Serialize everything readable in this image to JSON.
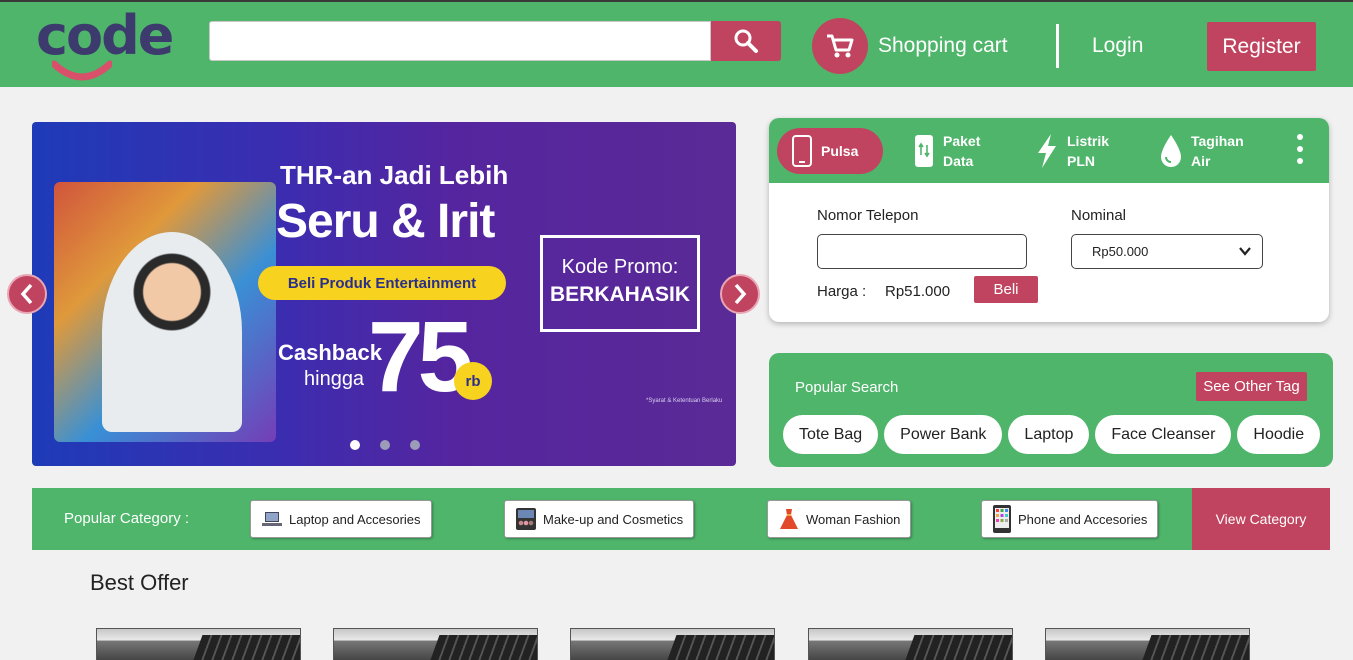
{
  "header": {
    "logo_text": "code",
    "search": {
      "value": "",
      "placeholder": ""
    },
    "cart_label": "Shopping cart",
    "login_label": "Login",
    "register_label": "Register"
  },
  "banner": {
    "line1": "THR-an Jadi Lebih",
    "line2": "Seru & Irit",
    "pill": "Beli Produk Entertainment",
    "cashback": "Cashback",
    "hingga": "hingga",
    "amount": "75",
    "unit": "rb",
    "promo_label": "Kode Promo:",
    "promo_code": "BERKAHASIK",
    "fine_print": "*Syarat & Ketentuan Berlaku",
    "slide_count": 3,
    "active_slide": 1
  },
  "payment": {
    "tabs": [
      {
        "label": "Pulsa",
        "icon": "phone-icon",
        "active": true
      },
      {
        "label_1": "Paket",
        "label_2": "Data",
        "icon": "data-package-icon"
      },
      {
        "label_1": "Listrik",
        "label_2": "PLN",
        "icon": "lightning-icon"
      },
      {
        "label_1": "Tagihan",
        "label_2": "Air",
        "icon": "water-drop-icon"
      }
    ],
    "phone_label": "Nomor Telepon",
    "phone_value": "",
    "nominal_label": "Nominal",
    "nominal_value": "Rp50.000",
    "price_label": "Harga :",
    "price_value": "Rp51.000",
    "buy_label": "Beli"
  },
  "popular_search": {
    "title": "Popular Search",
    "see_other": "See Other Tag",
    "tags": [
      "Tote Bag",
      "Power Bank",
      "Laptop",
      "Face Cleanser",
      "Hoodie"
    ]
  },
  "categories": {
    "label": "Popular Category :",
    "items": [
      {
        "label": "Laptop and Accesories",
        "icon": "laptop-icon"
      },
      {
        "label": "Make-up and Cosmetics",
        "icon": "makeup-palette-icon"
      },
      {
        "label": "Woman Fashion",
        "icon": "dress-icon"
      },
      {
        "label": "Phone and Accesories",
        "icon": "smartphone-icon"
      }
    ],
    "view_label": "View Category"
  },
  "best_offer": {
    "title": "Best Offer",
    "card_count": 5
  },
  "colors": {
    "green": "#4fb56b",
    "accent": "#c0445f",
    "background": "#f1f1f1"
  }
}
